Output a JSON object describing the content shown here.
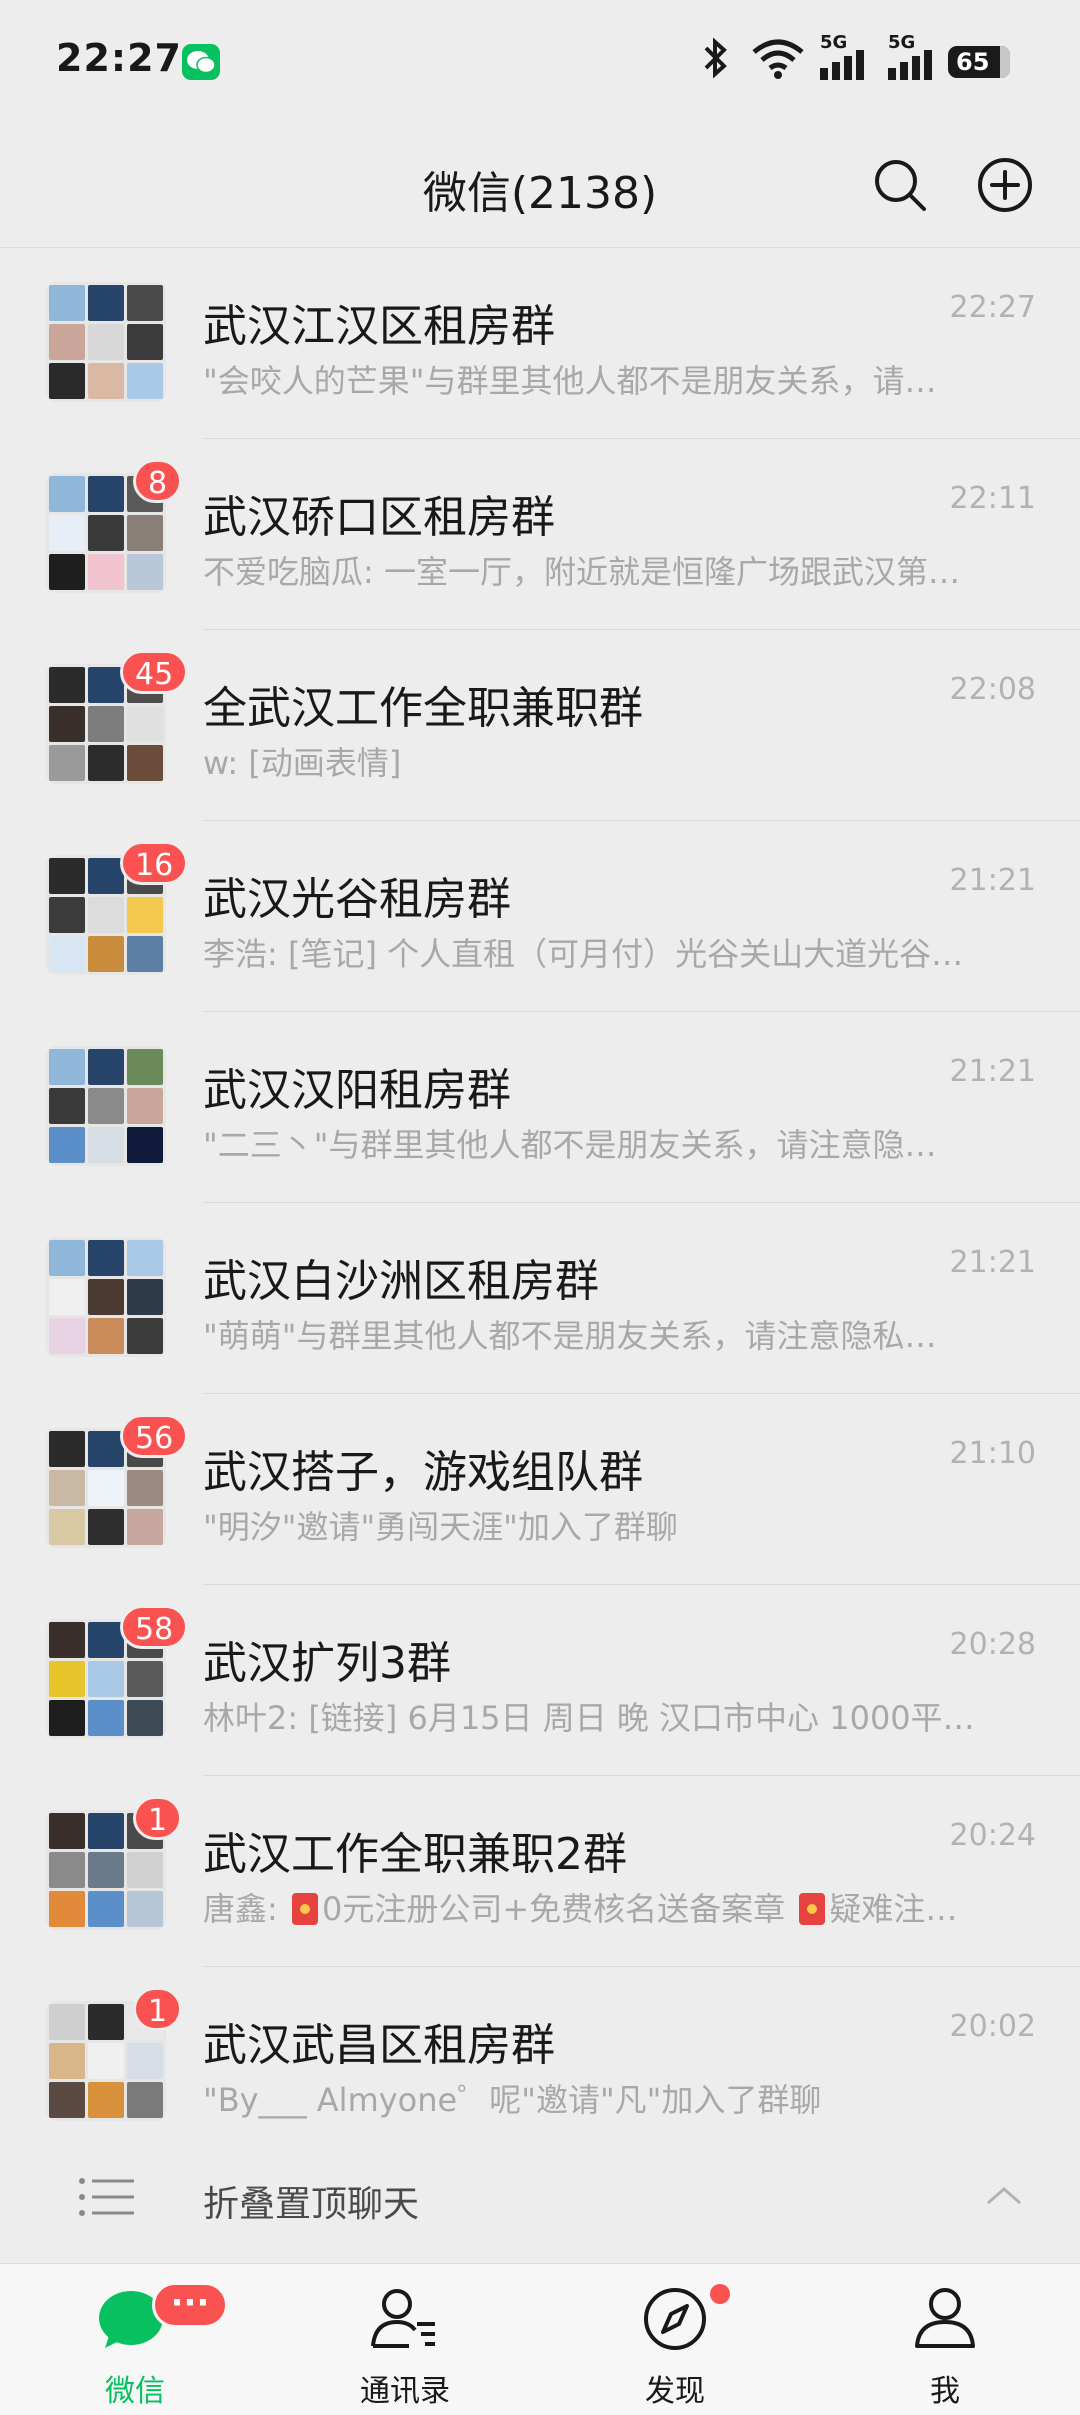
{
  "status_bar": {
    "time": "22:27",
    "battery": "65",
    "signal_label": "5G"
  },
  "header": {
    "title": "微信(2138)"
  },
  "chats": [
    {
      "name": "武汉江汉区租房群",
      "time": "22:27",
      "preview": "\"会咬人的芒果\"与群里其他人都不是朋友关系，请…",
      "badge": ""
    },
    {
      "name": "武汉硚口区租房群",
      "time": "22:11",
      "preview": "不爱吃脑瓜: 一室一厅，附近就是恒隆广场跟武汉第…",
      "badge": "8"
    },
    {
      "name": "全武汉工作全职兼职群",
      "time": "22:08",
      "preview": "w: [动画表情]",
      "badge": "45"
    },
    {
      "name": "武汉光谷租房群",
      "time": "21:21",
      "preview": "李浩: [笔记] 个人直租（可月付）光谷关山大道光谷…",
      "badge": "16"
    },
    {
      "name": "武汉汉阳租房群",
      "time": "21:21",
      "preview": "\"二三丶\"与群里其他人都不是朋友关系，请注意隐…",
      "badge": ""
    },
    {
      "name": "武汉白沙洲区租房群",
      "time": "21:21",
      "preview": "\"萌萌\"与群里其他人都不是朋友关系，请注意隐私…",
      "badge": ""
    },
    {
      "name": "武汉搭子，游戏组队群",
      "time": "21:10",
      "preview": "\"明汐\"邀请\"勇闯天涯\"加入了群聊",
      "badge": "56"
    },
    {
      "name": "武汉扩列3群",
      "time": "20:28",
      "preview": "林叶2: [链接] 6月15日 周日 晚 汉口市中心 1000平…",
      "badge": "58"
    },
    {
      "name": "武汉工作全职兼职2群",
      "time": "20:24",
      "preview_prefix": "唐鑫: ",
      "preview_mid": "0元注册公司+免费核名送备案章 ",
      "preview_end": "疑难注…",
      "badge": "1"
    },
    {
      "name": "武汉武昌区租房群",
      "time": "20:02",
      "preview": "\"By___ Almyone゜呢\"邀请\"凡\"加入了群聊",
      "badge": "1"
    }
  ],
  "fold": {
    "label": "折叠置顶聊天"
  },
  "tabbar": {
    "tabs": [
      {
        "label": "微信",
        "badge": "···"
      },
      {
        "label": "通讯录"
      },
      {
        "label": "发现"
      },
      {
        "label": "我"
      }
    ]
  },
  "colors": {
    "accent": "#07c160",
    "badge": "#fa5151",
    "background": "#ededed"
  },
  "icons": [
    "wechat-app-icon",
    "bluetooth-icon",
    "wifi-icon",
    "signal-icon",
    "battery-icon",
    "search-icon",
    "add-icon",
    "list-icon",
    "chevron-up-icon",
    "chat-icon",
    "contacts-icon",
    "discover-icon",
    "me-icon",
    "red-packet-icon"
  ]
}
